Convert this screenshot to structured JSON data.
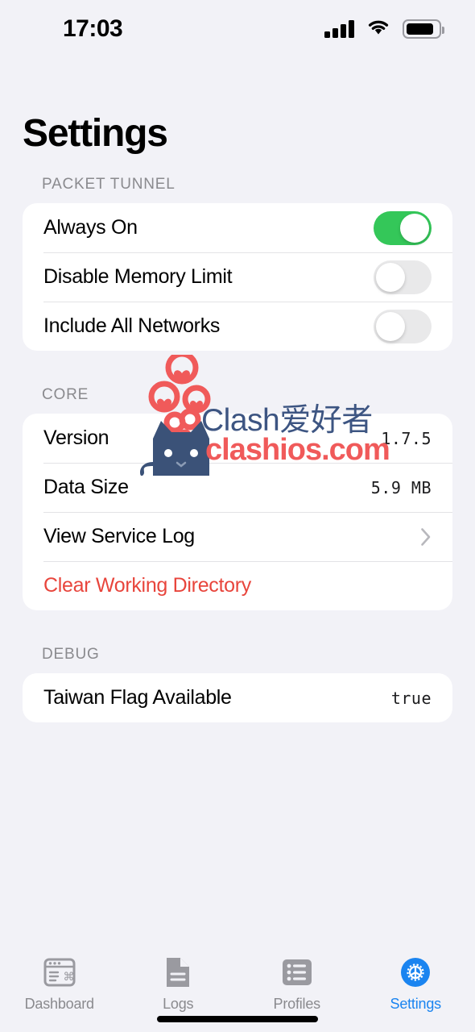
{
  "status_bar": {
    "time": "17:03",
    "signal_icon": "cellular-signal-icon",
    "wifi_icon": "wifi-icon",
    "battery_icon": "battery-icon"
  },
  "header": {
    "title": "Settings"
  },
  "sections": [
    {
      "id": "packet-tunnel",
      "header": "PACKET TUNNEL",
      "rows": [
        {
          "label": "Always On",
          "type": "toggle",
          "value": "on"
        },
        {
          "label": "Disable Memory Limit",
          "type": "toggle",
          "value": "off"
        },
        {
          "label": "Include All Networks",
          "type": "toggle",
          "value": "off"
        }
      ]
    },
    {
      "id": "core",
      "header": "CORE",
      "rows": [
        {
          "label": "Version",
          "type": "value",
          "value": "1.7.5"
        },
        {
          "label": "Data Size",
          "type": "value",
          "value": "5.9 MB"
        },
        {
          "label": "View Service Log",
          "type": "disclosure",
          "value": ""
        },
        {
          "label": "Clear Working Directory",
          "type": "destructive",
          "value": ""
        }
      ]
    },
    {
      "id": "debug",
      "header": "DEBUG",
      "rows": [
        {
          "label": "Taiwan Flag Available",
          "type": "value",
          "value": "true"
        }
      ]
    }
  ],
  "watermark": {
    "brand_cn": "Clash爱好者",
    "site": "clashios.com",
    "cat_icon": "cat-mascot-icon",
    "hearts_icon": "heart-bubbles-icon"
  },
  "tab_bar": {
    "tabs": [
      {
        "label": "Dashboard",
        "icon": "dashboard-window-icon",
        "active": false
      },
      {
        "label": "Logs",
        "icon": "document-icon",
        "active": false
      },
      {
        "label": "Profiles",
        "icon": "list-icon",
        "active": false
      },
      {
        "label": "Settings",
        "icon": "gear-icon",
        "active": true
      }
    ]
  },
  "colors": {
    "background": "#f2f2f7",
    "card": "#ffffff",
    "toggle_on": "#34c759",
    "toggle_off": "#e9e9ea",
    "destructive": "#e8453c",
    "accent": "#1a84f0",
    "secondary_text": "#8a8a8e",
    "watermark_blue": "#3d5582",
    "watermark_red": "#f05a5a"
  }
}
